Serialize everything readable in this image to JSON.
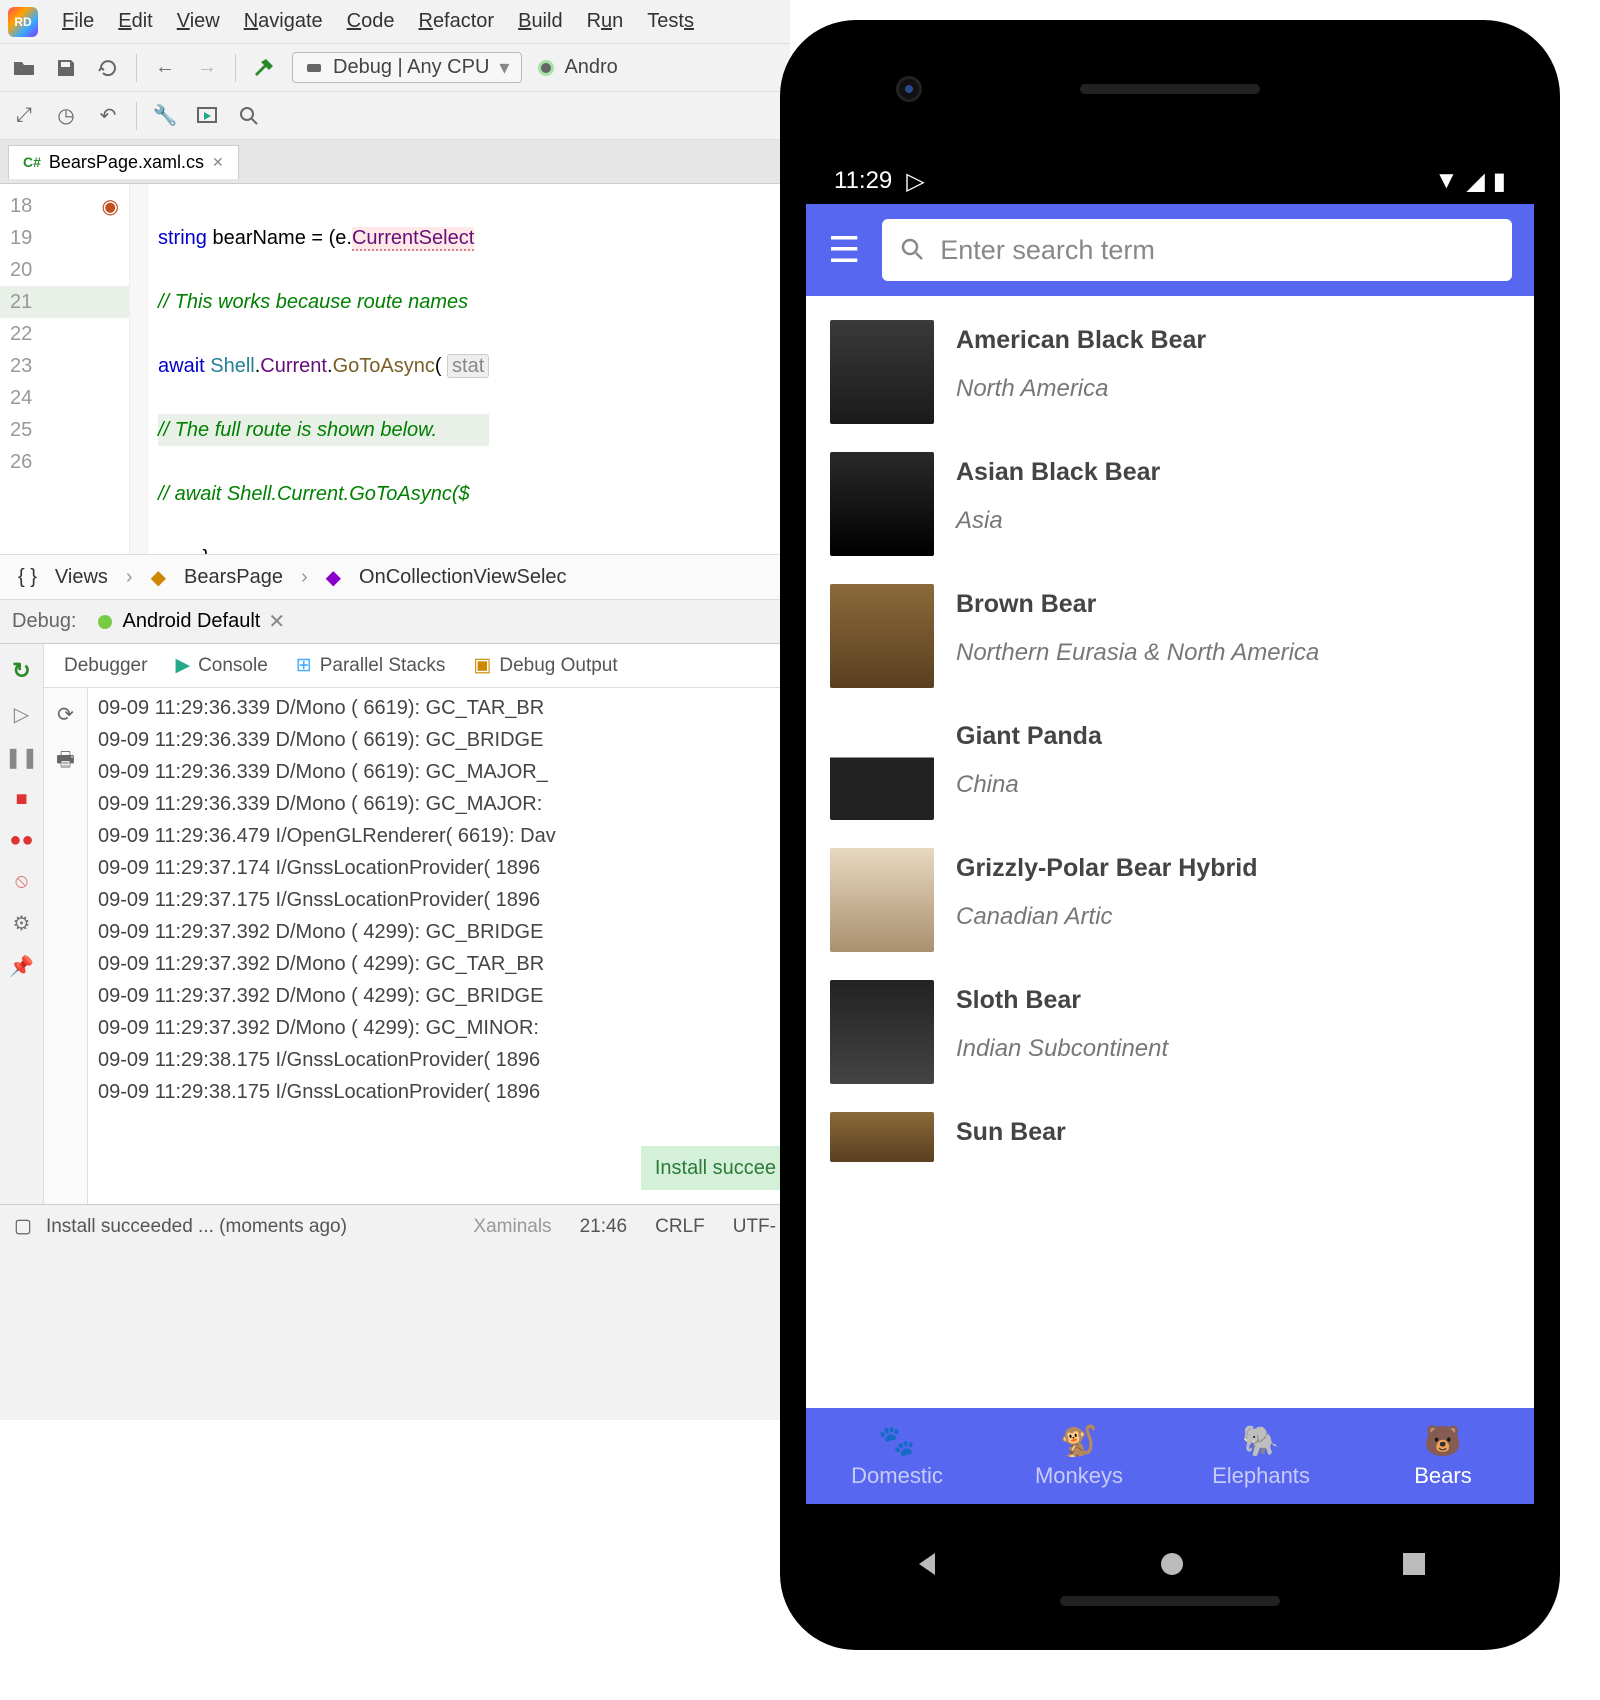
{
  "menu": [
    "File",
    "Edit",
    "View",
    "Navigate",
    "Code",
    "Refactor",
    "Build",
    "Run",
    "Tests"
  ],
  "run_config": "Debug | Any CPU",
  "run_target": "Andro",
  "tab_name": "BearsPage.xaml.cs",
  "code": {
    "lines": [
      18,
      19,
      20,
      21,
      22,
      23,
      24,
      25,
      26
    ],
    "l18_kw": "string",
    "l18_var": " bearName = (e.",
    "l18_prop": "CurrentSelect",
    "l19": "// This works because route names ",
    "l20_kw": "await ",
    "l20_t": "Shell",
    "l20_d1": ".",
    "l20_p": "Current",
    "l20_d2": ".",
    "l20_m": "GoToAsync",
    "l20_par": "( ",
    "l20_hint": "stat",
    "l21": "// The full route is shown below. ",
    "l22": "// await Shell.Current.GoToAsync($",
    "l23": "        }",
    "l24": "    }",
    "l25": "}"
  },
  "breadcrumb": [
    "Views",
    "BearsPage",
    "OnCollectionViewSelec"
  ],
  "debug_label": "Debug:",
  "debug_tab": "Android Default",
  "debug_panels": [
    "Debugger",
    "Console",
    "Parallel Stacks",
    "Debug Output"
  ],
  "console_lines": [
    "09-09 11:29:36.339 D/Mono    ( 6619): GC_TAR_BR",
    "09-09 11:29:36.339 D/Mono    ( 6619): GC_BRIDGE",
    "09-09 11:29:36.339 D/Mono    ( 6619): GC_MAJOR_",
    "09-09 11:29:36.339 D/Mono    ( 6619): GC_MAJOR:",
    "09-09 11:29:36.479 I/OpenGLRenderer( 6619): Dav",
    "09-09 11:29:37.174 I/GnssLocationProvider( 1896",
    "09-09 11:29:37.175 I/GnssLocationProvider( 1896",
    "09-09 11:29:37.392 D/Mono    ( 4299): GC_BRIDGE",
    "09-09 11:29:37.392 D/Mono    ( 4299): GC_TAR_BR",
    "09-09 11:29:37.392 D/Mono    ( 4299): GC_BRIDGE",
    "09-09 11:29:37.392 D/Mono    ( 4299): GC_MINOR:",
    "09-09 11:29:38.175 I/GnssLocationProvider( 1896",
    "09-09 11:29:38.175 I/GnssLocationProvider( 1896"
  ],
  "install_ok": "Install succee",
  "status": {
    "msg": "Install succeeded ... (moments ago)",
    "proj": "Xaminals",
    "pos": "21:46",
    "eol": "CRLF",
    "enc": "UTF-"
  },
  "phone": {
    "time": "11:29",
    "search_placeholder": "Enter search term",
    "bears": [
      {
        "title": "American Black Bear",
        "sub": "North America"
      },
      {
        "title": "Asian Black Bear",
        "sub": "Asia"
      },
      {
        "title": "Brown Bear",
        "sub": "Northern Eurasia & North America"
      },
      {
        "title": "Giant Panda",
        "sub": "China"
      },
      {
        "title": "Grizzly-Polar Bear Hybrid",
        "sub": "Canadian Artic"
      },
      {
        "title": "Sloth Bear",
        "sub": "Indian Subcontinent"
      },
      {
        "title": "Sun Bear",
        "sub": ""
      }
    ],
    "tabs": [
      "Domestic",
      "Monkeys",
      "Elephants",
      "Bears"
    ]
  }
}
